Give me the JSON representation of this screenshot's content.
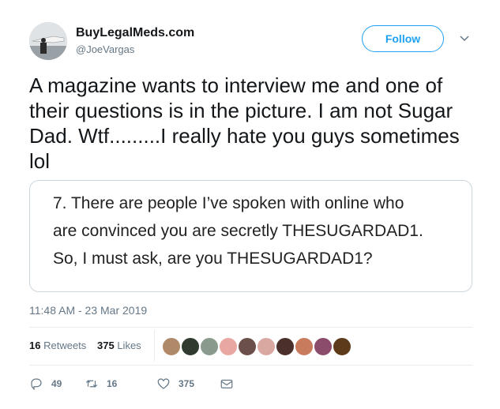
{
  "user": {
    "display_name": "BuyLegalMeds.com",
    "handle": "@JoeVargas",
    "avatar_icon": "avatar-photo"
  },
  "follow_label": "Follow",
  "menu_icon": "chevron-down-icon",
  "tweet": {
    "text": "A magazine wants to interview me and one of their questions is in the picture. I am not Sugar Dad. Wtf.........I really hate you guys sometimes lol"
  },
  "media": {
    "lines": [
      "7. There are people I’ve spoken with online who",
      "are convinced you are secretly THESUGARDAD1.",
      "So, I must ask, are you THESUGARDAD1?"
    ]
  },
  "timestamp": "11:48 AM - 23 Mar 2019",
  "stats": {
    "retweets_count": "16",
    "retweets_label": "Retweets",
    "likes_count": "375",
    "likes_label": "Likes"
  },
  "likers": [
    {
      "color": "#b08968"
    },
    {
      "color": "#2f3b2e"
    },
    {
      "color": "#8a9a8c"
    },
    {
      "color": "#e8a7a0"
    },
    {
      "color": "#6b4f4a"
    },
    {
      "color": "#d9a8a1"
    },
    {
      "color": "#4a2f2a"
    },
    {
      "color": "#c97b5e"
    },
    {
      "color": "#8b4c6b"
    },
    {
      "color": "#5d3a1a"
    }
  ],
  "actions": {
    "reply_count": "49",
    "retweet_count": "16",
    "like_count": "375"
  },
  "colors": {
    "accent": "#1da1f2",
    "muted": "#657786",
    "border": "#e6ecf0"
  }
}
